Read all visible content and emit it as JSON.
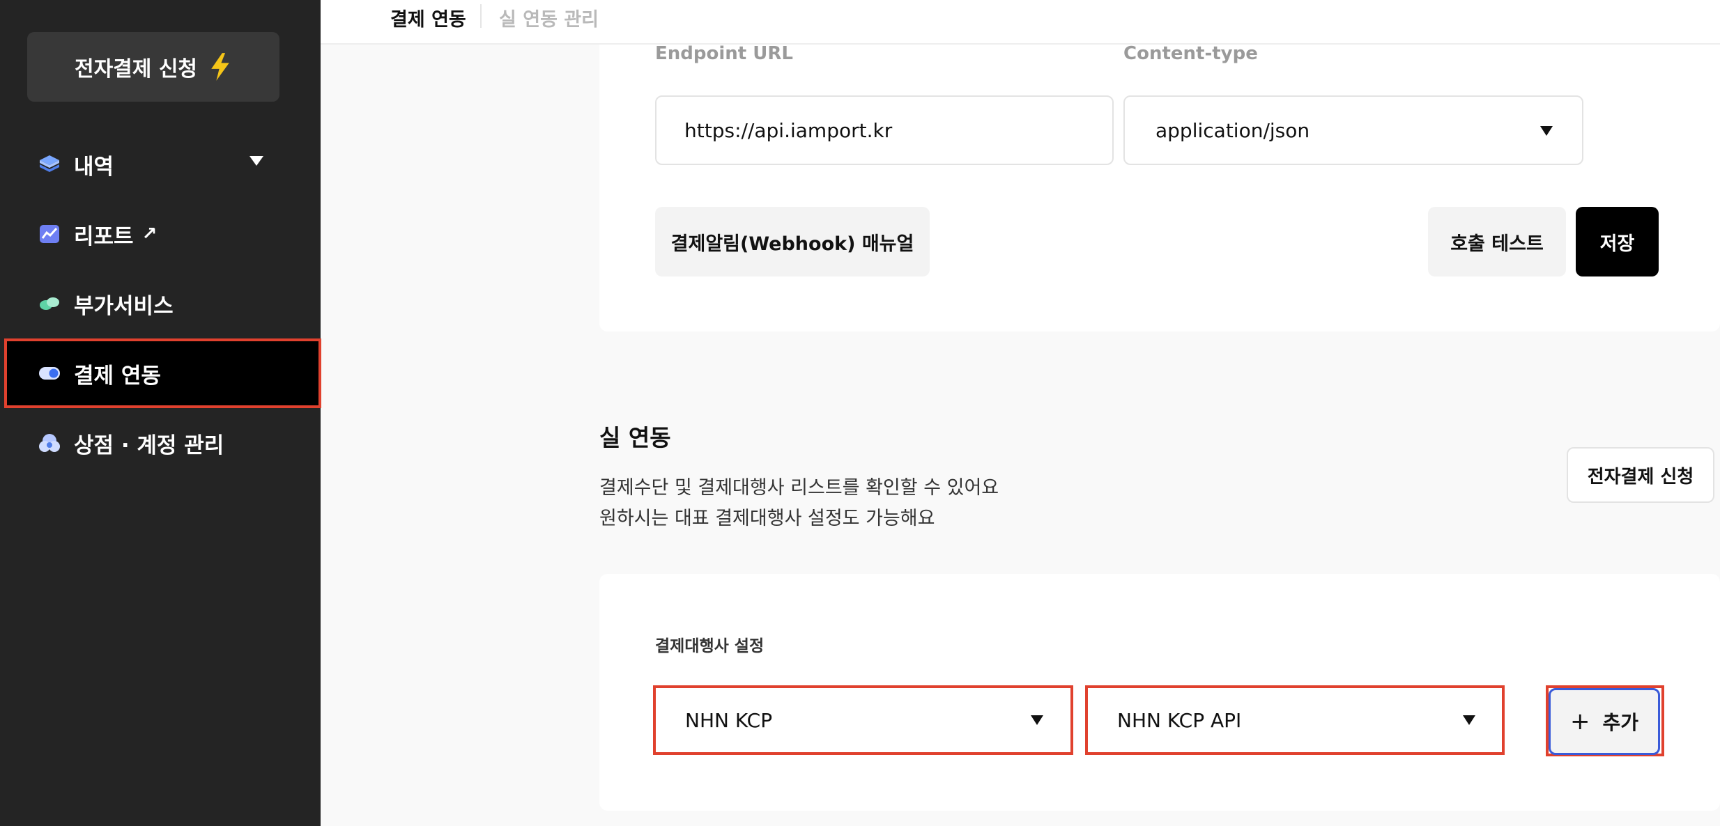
{
  "sidebar": {
    "apply_button": "전자결제 신청",
    "items": [
      {
        "label": "내역",
        "icon": "layers-icon"
      },
      {
        "label": "리포트",
        "icon": "chart-icon",
        "ext": "↗"
      },
      {
        "label": "부가서비스",
        "icon": "pills-icon"
      },
      {
        "label": "결제 연동",
        "icon": "toggle-icon"
      },
      {
        "label": "상점 · 계정 관리",
        "icon": "cloud-users-icon"
      }
    ]
  },
  "tabs": [
    {
      "label": "결제 연동"
    },
    {
      "label": "실 연동 관리"
    }
  ],
  "webhook": {
    "endpoint_label": "Endpoint URL",
    "endpoint_value": "https://api.iamport.kr",
    "content_type_label": "Content-type",
    "content_type_value": "application/json",
    "manual_button": "결제알림(Webhook) 매뉴얼",
    "test_button": "호출 테스트",
    "save_button": "저장"
  },
  "live": {
    "title": "실 연동",
    "desc_line1": "결제수단 및 결제대행사 리스트를 확인할 수 있어요",
    "desc_line2": "원하시는 대표 결제대행사 설정도 가능해요",
    "apply_button": "전자결제 신청",
    "pg_setting_label": "결제대행사 설정",
    "pg_select": "NHN KCP",
    "pg_type_select": "NHN KCP API",
    "add_button": "추가"
  },
  "colors": {
    "sidebar_bg": "#242424",
    "highlight": "#e0412e",
    "accent_blue": "#3a5bd9"
  }
}
